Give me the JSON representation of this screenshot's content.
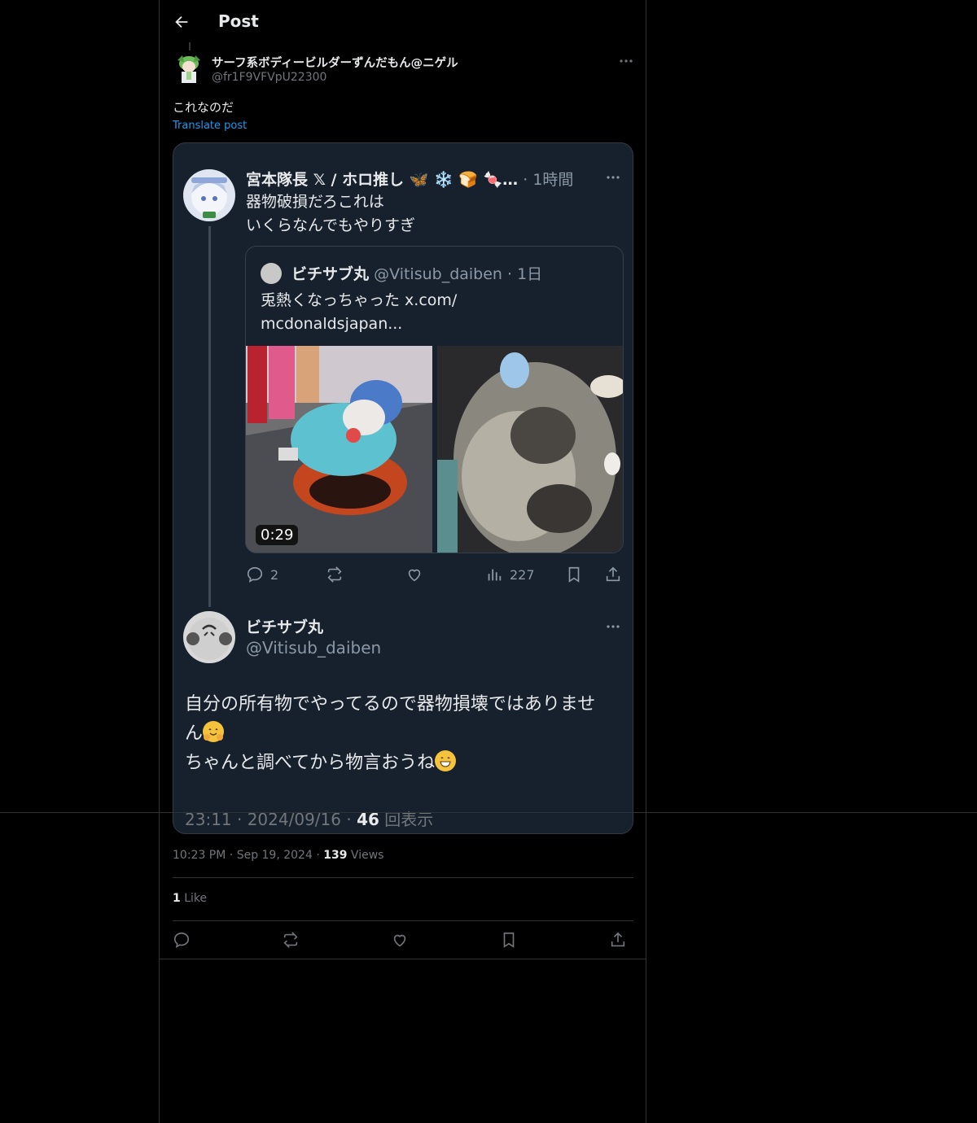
{
  "header": {
    "title": "Post"
  },
  "post": {
    "author_name": "サーフ系ボディービルダーずんだもん@ニゲル",
    "author_handle": "@fr1F9VFVpU22300",
    "text": "これなのだ",
    "translate_label": "Translate post",
    "time": "10:23 PM",
    "date": "Sep 19, 2024",
    "views_count": "139",
    "views_label": "Views",
    "likes_count": "1",
    "likes_label": "Like"
  },
  "quoted": {
    "author_name": "宮本隊長 𝕏 / ホロ推し 🦋 ❄️ 🍞 🍬…",
    "age": "· 1時間",
    "text_line1": "器物破損だろこれは",
    "text_line2": "いくらなんでもやりすぎ",
    "inner": {
      "author_name": "ビチサブ丸",
      "handle_age": "@Vitisub_daiben · 1日",
      "text": "兎熱くなっちゃった x.com/ mcdonaldsjapan...",
      "video_duration": "0:29"
    },
    "replies_count": "2",
    "views_count": "227"
  },
  "reply": {
    "author_name": "ビチサブ丸",
    "author_handle": "@Vitisub_daiben",
    "text_line1": "自分の所有物でやってるので器物損壊ではありませ",
    "text_line2": "ん",
    "text_line3": "ちゃんと調べてから物言おうね",
    "timestamp": "23:11 · 2024/09/16 ·",
    "views_count": "46",
    "views_label": "回表示"
  },
  "colors": {
    "background": "#000000",
    "text": "#e7e9ea",
    "muted": "#71767b",
    "link": "#1d9bf0",
    "card_bg": "#17202d"
  },
  "icons": [
    "back-arrow-icon",
    "more-icon",
    "reply-icon",
    "repost-icon",
    "like-icon",
    "views-icon",
    "bookmark-icon",
    "share-icon"
  ]
}
